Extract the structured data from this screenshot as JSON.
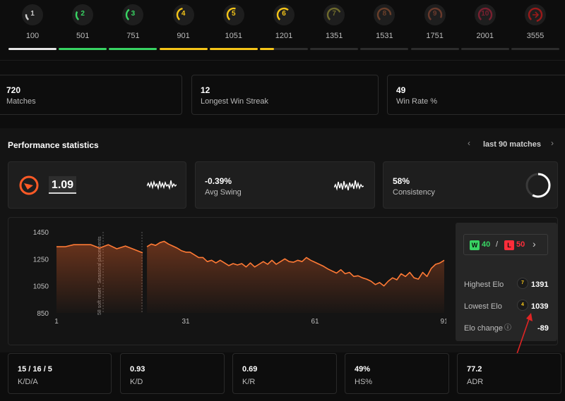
{
  "levels": [
    {
      "num": "1",
      "value": "100",
      "color": "#cfcfcf",
      "bar": 1.0,
      "barColor": "#e6e6e6"
    },
    {
      "num": "2",
      "value": "501",
      "color": "#38d463",
      "bar": 1.0,
      "barColor": "#38d463"
    },
    {
      "num": "3",
      "value": "751",
      "color": "#38d463",
      "bar": 1.0,
      "barColor": "#38d463"
    },
    {
      "num": "4",
      "value": "901",
      "color": "#f5c518",
      "bar": 1.0,
      "barColor": "#f5c518"
    },
    {
      "num": "5",
      "value": "1051",
      "color": "#f5c518",
      "bar": 1.0,
      "barColor": "#f5c518"
    },
    {
      "num": "6",
      "value": "1201",
      "color": "#f5c518",
      "bar": 0.3,
      "barColor": "#f5c518"
    },
    {
      "num": "7",
      "value": "1351",
      "color": "#6e6a2c",
      "bar": 0,
      "barColor": "#6e6a2c"
    },
    {
      "num": "8",
      "value": "1531",
      "color": "#6a3f2a",
      "bar": 0,
      "barColor": "#6a3f2a"
    },
    {
      "num": "9",
      "value": "1751",
      "color": "#6a3a2c",
      "bar": 0,
      "barColor": "#6a3a2c"
    },
    {
      "num": "10",
      "value": "2001",
      "color": "#7a2030",
      "bar": 0,
      "barColor": "#7a2030"
    },
    {
      "num": "",
      "value": "3555",
      "color": "#9a1a1a",
      "bar": 0,
      "barColor": "#9a1a1a"
    }
  ],
  "summary": [
    {
      "value": "720",
      "label": "Matches"
    },
    {
      "value": "12",
      "label": "Longest Win Streak"
    },
    {
      "value": "49",
      "label": "Win Rate %"
    }
  ],
  "performance": {
    "title": "Performance statistics",
    "prev": "‹",
    "next": "›",
    "range": "last 90 matches",
    "rating": "1.09",
    "avg_swing_value": "-0.39%",
    "avg_swing_label": "Avg Swing",
    "consistency_value": "58%",
    "consistency_label": "Consistency",
    "consistency_level": 0.58
  },
  "chart_data": {
    "type": "line",
    "x_ticks": [
      "1",
      "31",
      "61",
      "91"
    ],
    "y_ticks": [
      "1450",
      "1250",
      "1050",
      "850"
    ],
    "xlim": [
      1,
      91
    ],
    "ylim": [
      850,
      1450
    ],
    "annotation": "58 soft reset - Seasonal placements",
    "segments": [
      {
        "x": [
          1,
          3,
          5,
          7,
          9,
          11,
          13,
          15,
          17,
          19,
          21
        ],
        "y": [
          1340,
          1340,
          1355,
          1355,
          1355,
          1330,
          1355,
          1325,
          1345,
          1320,
          1295
        ]
      },
      {
        "x": [
          22,
          23,
          24,
          25,
          26,
          27,
          28,
          29,
          30,
          31,
          32,
          33,
          34,
          35,
          36,
          37,
          38,
          39,
          40,
          41,
          42,
          43,
          44,
          45,
          46,
          47,
          48,
          49,
          50,
          51,
          52,
          53,
          54,
          55,
          56,
          57,
          58,
          59,
          60,
          61,
          62,
          63,
          64,
          65,
          66,
          67,
          68,
          69,
          70,
          71,
          72,
          73,
          74,
          75,
          76,
          77,
          78,
          79,
          80,
          81,
          82,
          83,
          84,
          85,
          86,
          87,
          88,
          89,
          90,
          91
        ],
        "y": [
          1340,
          1360,
          1350,
          1370,
          1380,
          1360,
          1345,
          1330,
          1310,
          1300,
          1300,
          1280,
          1260,
          1260,
          1230,
          1240,
          1220,
          1240,
          1220,
          1200,
          1215,
          1205,
          1215,
          1190,
          1220,
          1190,
          1210,
          1230,
          1210,
          1240,
          1210,
          1230,
          1250,
          1230,
          1225,
          1240,
          1230,
          1260,
          1240,
          1225,
          1210,
          1195,
          1175,
          1160,
          1145,
          1170,
          1140,
          1150,
          1120,
          1125,
          1110,
          1100,
          1085,
          1060,
          1075,
          1050,
          1085,
          1110,
          1095,
          1140,
          1120,
          1150,
          1110,
          1100,
          1150,
          1120,
          1180,
          1210,
          1220,
          1240
        ]
      }
    ]
  },
  "record": {
    "w_badge": "W",
    "wins": "40",
    "sep": "/",
    "l_badge": "L",
    "losses": "50",
    "arrow": "›"
  },
  "elo": [
    {
      "label": "Highest Elo",
      "badge": "7",
      "badgeColor": "#f5c518",
      "value": "1391"
    },
    {
      "label": "Lowest Elo",
      "badge": "4",
      "badgeColor": "#f5c518",
      "value": "1039"
    },
    {
      "label": "Elo change",
      "info": "ⓘ",
      "value": "-89"
    }
  ],
  "bottom": [
    {
      "value": "15 / 16 / 5",
      "label": "K/D/A"
    },
    {
      "value": "0.93",
      "label": "K/D"
    },
    {
      "value": "0.69",
      "label": "K/R"
    },
    {
      "value": "49%",
      "label": "HS%"
    },
    {
      "value": "77.2",
      "label": "ADR"
    }
  ]
}
